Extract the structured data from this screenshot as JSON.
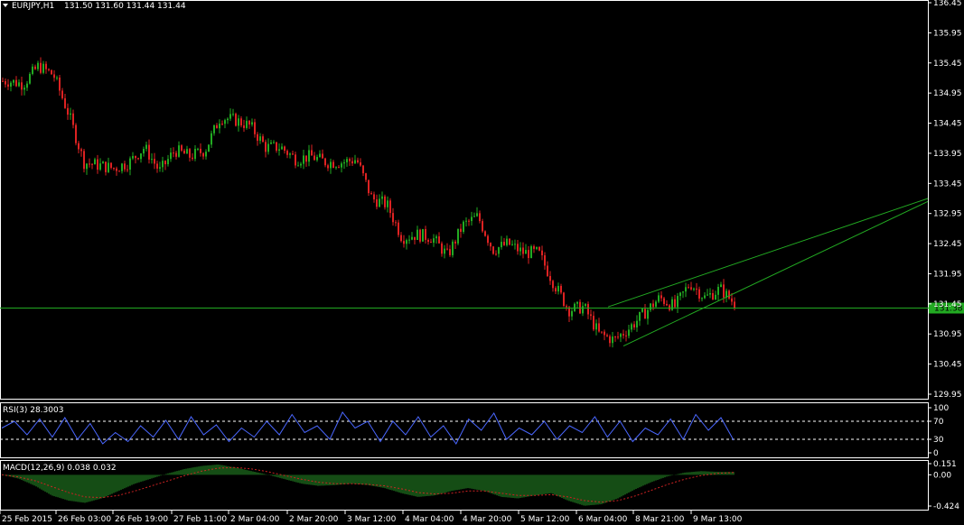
{
  "header": {
    "symbol": "EURJPY,H1",
    "ohlc": "131.50 131.60 131.44 131.44"
  },
  "colors": {
    "background": "#000000",
    "grid": "#ffffff",
    "bull": "#22aa22",
    "bear": "#dd2222",
    "line": "#22aa22",
    "rsi": "#4a67ff",
    "macd_hist": "#2a9a2a",
    "macd_signal": "#cc2222"
  },
  "chart_data": [
    {
      "type": "candlestick",
      "panel": "price",
      "y_ticks": [
        "136.45",
        "135.95",
        "135.45",
        "134.95",
        "134.45",
        "133.95",
        "133.45",
        "132.95",
        "132.45",
        "131.95",
        "131.45",
        "130.95",
        "130.45",
        "129.95"
      ],
      "ylim": [
        129.95,
        136.45
      ],
      "current_price": "131.38",
      "horizontal_line": 131.38,
      "trendlines": [
        {
          "from": [
            "6 Mar 04:00",
            131.4
          ],
          "to": [
            "9 Mar 20:00",
            133.2
          ]
        },
        {
          "from": [
            "7 Mar 00:00",
            130.75
          ],
          "to": [
            "9 Mar 20:00",
            133.15
          ]
        }
      ],
      "close_path": [
        [
          "25 Feb 2015",
          135.15
        ],
        [
          "25 Feb 12:00",
          135.1
        ],
        [
          "26 Feb 00:00",
          135.4
        ],
        [
          "26 Feb 03:00",
          135.25
        ],
        [
          "26 Feb 09:00",
          134.6
        ],
        [
          "26 Feb 12:00",
          133.8
        ],
        [
          "26 Feb 16:00",
          133.75
        ],
        [
          "26 Feb 19:00",
          133.7
        ],
        [
          "27 Feb 00:00",
          133.8
        ],
        [
          "27 Feb 05:00",
          134.05
        ],
        [
          "27 Feb 08:00",
          133.65
        ],
        [
          "27 Feb 11:00",
          134.0
        ],
        [
          "27 Feb 16:00",
          133.9
        ],
        [
          "27 Feb 20:00",
          134.0
        ],
        [
          "2 Mar 00:00",
          134.55
        ],
        [
          "2 Mar 04:00",
          134.5
        ],
        [
          "2 Mar 12:00",
          134.4
        ],
        [
          "2 Mar 16:00",
          134.05
        ],
        [
          "2 Mar 20:00",
          134.05
        ],
        [
          "3 Mar 00:00",
          133.85
        ],
        [
          "3 Mar 06:00",
          133.9
        ],
        [
          "3 Mar 12:00",
          133.8
        ],
        [
          "3 Mar 18:00",
          133.8
        ],
        [
          "3 Mar 22:00",
          133.85
        ],
        [
          "4 Mar 00:00",
          133.2
        ],
        [
          "4 Mar 04:00",
          133.1
        ],
        [
          "4 Mar 08:00",
          132.55
        ],
        [
          "4 Mar 12:00",
          132.6
        ],
        [
          "4 Mar 16:00",
          132.55
        ],
        [
          "4 Mar 18:00",
          132.25
        ],
        [
          "4 Mar 20:00",
          132.75
        ],
        [
          "4 Mar 22:00",
          132.9
        ],
        [
          "5 Mar 00:00",
          132.35
        ],
        [
          "5 Mar 06:00",
          132.45
        ],
        [
          "5 Mar 12:00",
          132.3
        ],
        [
          "5 Mar 18:00",
          132.3
        ],
        [
          "6 Mar 00:00",
          131.8
        ],
        [
          "6 Mar 04:00",
          131.35
        ],
        [
          "6 Mar 08:00",
          131.4
        ],
        [
          "6 Mar 12:00",
          130.95
        ],
        [
          "6 Mar 16:00",
          130.85
        ],
        [
          "6 Mar 20:00",
          131.05
        ],
        [
          "8 Mar 21:00",
          131.3
        ],
        [
          "9 Mar 01:00",
          131.55
        ],
        [
          "9 Mar 05:00",
          131.4
        ],
        [
          "9 Mar 09:00",
          131.8
        ],
        [
          "9 Mar 13:00",
          131.55
        ],
        [
          "9 Mar 17:00",
          131.7
        ],
        [
          "9 Mar 19:00",
          131.44
        ]
      ]
    },
    {
      "type": "line",
      "panel": "rsi",
      "label": "RSI(3) 28.3003",
      "y_ticks": [
        "100",
        "70",
        "30",
        "0"
      ],
      "ylim": [
        0,
        100
      ],
      "levels": [
        70,
        30
      ],
      "values": [
        55,
        70,
        40,
        75,
        35,
        78,
        30,
        65,
        20,
        45,
        25,
        60,
        35,
        72,
        30,
        80,
        40,
        62,
        25,
        55,
        35,
        70,
        40,
        85,
        45,
        60,
        30,
        90,
        55,
        70,
        25,
        70,
        40,
        80,
        35,
        60,
        20,
        75,
        50,
        88,
        30,
        55,
        40,
        70,
        30,
        60,
        45,
        80,
        35,
        70,
        25,
        55,
        40,
        75,
        30,
        85,
        50,
        78,
        28
      ]
    },
    {
      "type": "bar",
      "panel": "macd",
      "label": "MACD(12,26,9) 0.038 0.032",
      "y_ticks": [
        "0.151",
        "0.00",
        "-0.424"
      ],
      "ylim": [
        -0.424,
        0.151
      ],
      "values": [
        0.0,
        -0.05,
        -0.15,
        -0.28,
        -0.35,
        -0.38,
        -0.32,
        -0.22,
        -0.12,
        -0.05,
        0.02,
        0.08,
        0.12,
        0.14,
        0.1,
        0.05,
        0.0,
        -0.06,
        -0.12,
        -0.15,
        -0.14,
        -0.12,
        -0.14,
        -0.18,
        -0.25,
        -0.3,
        -0.28,
        -0.22,
        -0.18,
        -0.22,
        -0.3,
        -0.32,
        -0.28,
        -0.25,
        -0.35,
        -0.42,
        -0.4,
        -0.32,
        -0.2,
        -0.1,
        -0.02,
        0.03,
        0.05,
        0.04,
        0.038
      ],
      "signal": [
        0.0,
        -0.03,
        -0.08,
        -0.16,
        -0.24,
        -0.3,
        -0.31,
        -0.28,
        -0.22,
        -0.15,
        -0.08,
        -0.01,
        0.05,
        0.09,
        0.1,
        0.08,
        0.04,
        -0.01,
        -0.06,
        -0.1,
        -0.12,
        -0.12,
        -0.13,
        -0.15,
        -0.19,
        -0.24,
        -0.26,
        -0.25,
        -0.22,
        -0.22,
        -0.25,
        -0.28,
        -0.28,
        -0.27,
        -0.3,
        -0.35,
        -0.37,
        -0.35,
        -0.29,
        -0.21,
        -0.13,
        -0.06,
        -0.01,
        0.02,
        0.032
      ]
    },
    {
      "type": "time_axis",
      "labels": [
        "25 Feb 2015",
        "26 Feb 03:00",
        "26 Feb 19:00",
        "27 Feb 11:00",
        "2 Mar 04:00",
        "2 Mar 20:00",
        "3 Mar 12:00",
        "4 Mar 04:00",
        "4 Mar 20:00",
        "5 Mar 12:00",
        "6 Mar 04:00",
        "8 Mar 21:00",
        "9 Mar 13:00"
      ]
    }
  ]
}
